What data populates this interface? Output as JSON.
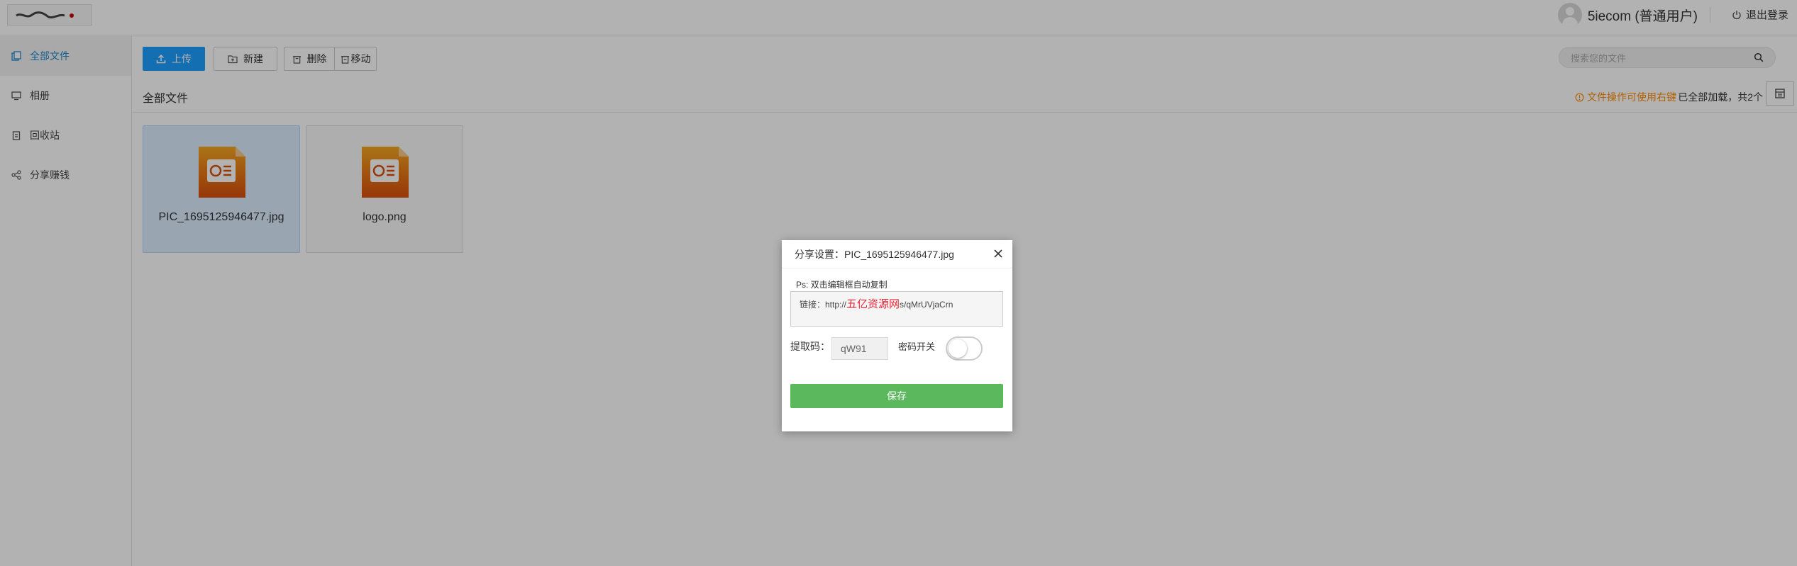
{
  "header": {
    "user_name": "5iecom (普通用户)",
    "logout_label": "退出登录"
  },
  "sidebar": {
    "items": [
      {
        "label": "全部文件",
        "icon": "files-icon",
        "active": true
      },
      {
        "label": "相册",
        "icon": "monitor-icon",
        "active": false
      },
      {
        "label": "回收站",
        "icon": "trash-icon",
        "active": false
      },
      {
        "label": "分享赚钱",
        "icon": "share-icon",
        "active": false
      }
    ]
  },
  "toolbar": {
    "upload_label": "上传",
    "new_label": "新建",
    "delete_label": "删除",
    "move_label": "移动",
    "search_placeholder": "搜索您的文件"
  },
  "breadcrumb": {
    "current": "全部文件",
    "hint": "文件操作可使用右键",
    "loaded_status": "已全部加载，共2个"
  },
  "files": [
    {
      "name": "PIC_1695125946477.jpg",
      "selected": true
    },
    {
      "name": "logo.png",
      "selected": false
    }
  ],
  "dialog": {
    "title": "分享设置：PIC_1695125946477.jpg",
    "ps": "Ps: 双击编辑框自动复制",
    "link_prefix": "链接：http://",
    "link_watermark": "五亿资源网",
    "link_suffix": "s/qMrUVjaCrn",
    "code_label": "提取码：",
    "code_value": "qW91",
    "password_label": "密码开关",
    "password_enabled": false,
    "save_label": "保存"
  },
  "colors": {
    "primary": "#1e9fff",
    "active_nav": "#1e87d0",
    "hint": "#ff8c00",
    "save": "#5cb85c"
  }
}
